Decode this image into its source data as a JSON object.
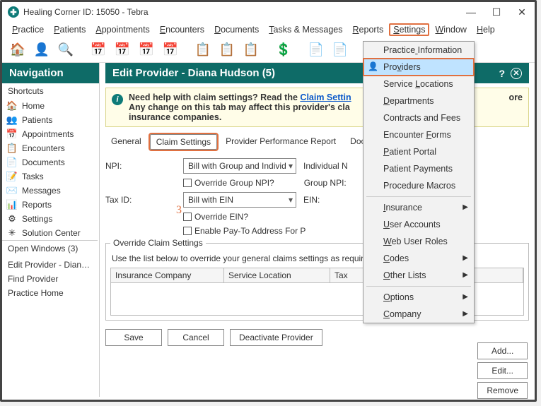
{
  "window": {
    "title": "Healing Corner ID: 15050 - Tebra"
  },
  "menubar": [
    "Practice",
    "Patients",
    "Appointments",
    "Encounters",
    "Documents",
    "Tasks & Messages",
    "Reports",
    "Settings",
    "Window",
    "Help"
  ],
  "menubar_active_index": 7,
  "settings_menu": {
    "items": [
      {
        "label": "Practice Information",
        "u": 8
      },
      {
        "label": "Providers",
        "u": 3,
        "highlight": true,
        "icon": "👤"
      },
      {
        "label": "Service Locations",
        "u": 8
      },
      {
        "label": "Departments",
        "u": 0
      },
      {
        "label": "Contracts and Fees"
      },
      {
        "label": "Encounter Forms",
        "u": 10
      },
      {
        "label": "Patient Portal",
        "u": 0
      },
      {
        "label": "Patient Payments"
      },
      {
        "label": "Procedure Macros"
      },
      {
        "sep": true
      },
      {
        "label": "Insurance",
        "u": 0,
        "sub": true
      },
      {
        "label": "User Accounts",
        "u": 0
      },
      {
        "label": "Web User Roles",
        "u": 0
      },
      {
        "label": "Codes",
        "u": 0,
        "sub": true
      },
      {
        "label": "Other Lists",
        "u": 0,
        "sub": true
      },
      {
        "sep": true
      },
      {
        "label": "Options",
        "u": 0,
        "sub": true
      },
      {
        "label": "Company",
        "u": 0,
        "sub": true
      }
    ]
  },
  "nav": {
    "header": "Navigation",
    "shortcuts_label": "Shortcuts",
    "shortcuts": [
      {
        "icon": "🏠",
        "label": "Home"
      },
      {
        "icon": "👥",
        "label": "Patients"
      },
      {
        "icon": "📅",
        "label": "Appointments"
      },
      {
        "icon": "📋",
        "label": "Encounters"
      },
      {
        "icon": "📄",
        "label": "Documents"
      },
      {
        "icon": "📝",
        "label": "Tasks"
      },
      {
        "icon": "✉️",
        "label": "Messages"
      },
      {
        "icon": "📊",
        "label": "Reports"
      },
      {
        "icon": "⚙",
        "label": "Settings"
      },
      {
        "icon": "✳",
        "label": "Solution Center"
      }
    ],
    "openwin_label": "Open Windows (3)",
    "open_windows": [
      "Edit Provider - Diana ...",
      "Find Provider",
      "Practice Home"
    ]
  },
  "edit": {
    "header": "Edit Provider - Diana Hudson (5)",
    "notice_lead": "Need help with claim settings? Read the ",
    "notice_link": "Claim Settin",
    "notice_line2": "Any change on this tab may affect this provider's cla",
    "notice_line3": "insurance companies.",
    "learn_more": "ore",
    "tabs": [
      "General",
      "Claim Settings",
      "Provider Performance Report",
      "Documents"
    ],
    "active_tab_index": 1,
    "annotation_3": "3",
    "form": {
      "npi_label": "NPI:",
      "npi_select": "Bill with Group and Individ",
      "npi_indiv_label": "Individual N",
      "npi_group_label": "Group NPI:",
      "chk_override_npi": "Override Group NPI?",
      "taxid_label": "Tax ID:",
      "taxid_select": "Bill with EIN",
      "ein_label": "EIN:",
      "chk_override_ein": "Override EIN?",
      "chk_payto": "Enable Pay-To Address For P"
    },
    "override": {
      "legend": "Override Claim Settings",
      "hint": "Use the list below to override your general claims settings as required",
      "cols": [
        "Insurance Company",
        "Service Location",
        "Tax"
      ]
    },
    "right_buttons": {
      "add": "Add...",
      "edit": "Edit...",
      "remove": "Remove"
    },
    "bottom_buttons": {
      "save": "Save",
      "cancel": "Cancel",
      "deact": "Deactivate Provider"
    }
  }
}
